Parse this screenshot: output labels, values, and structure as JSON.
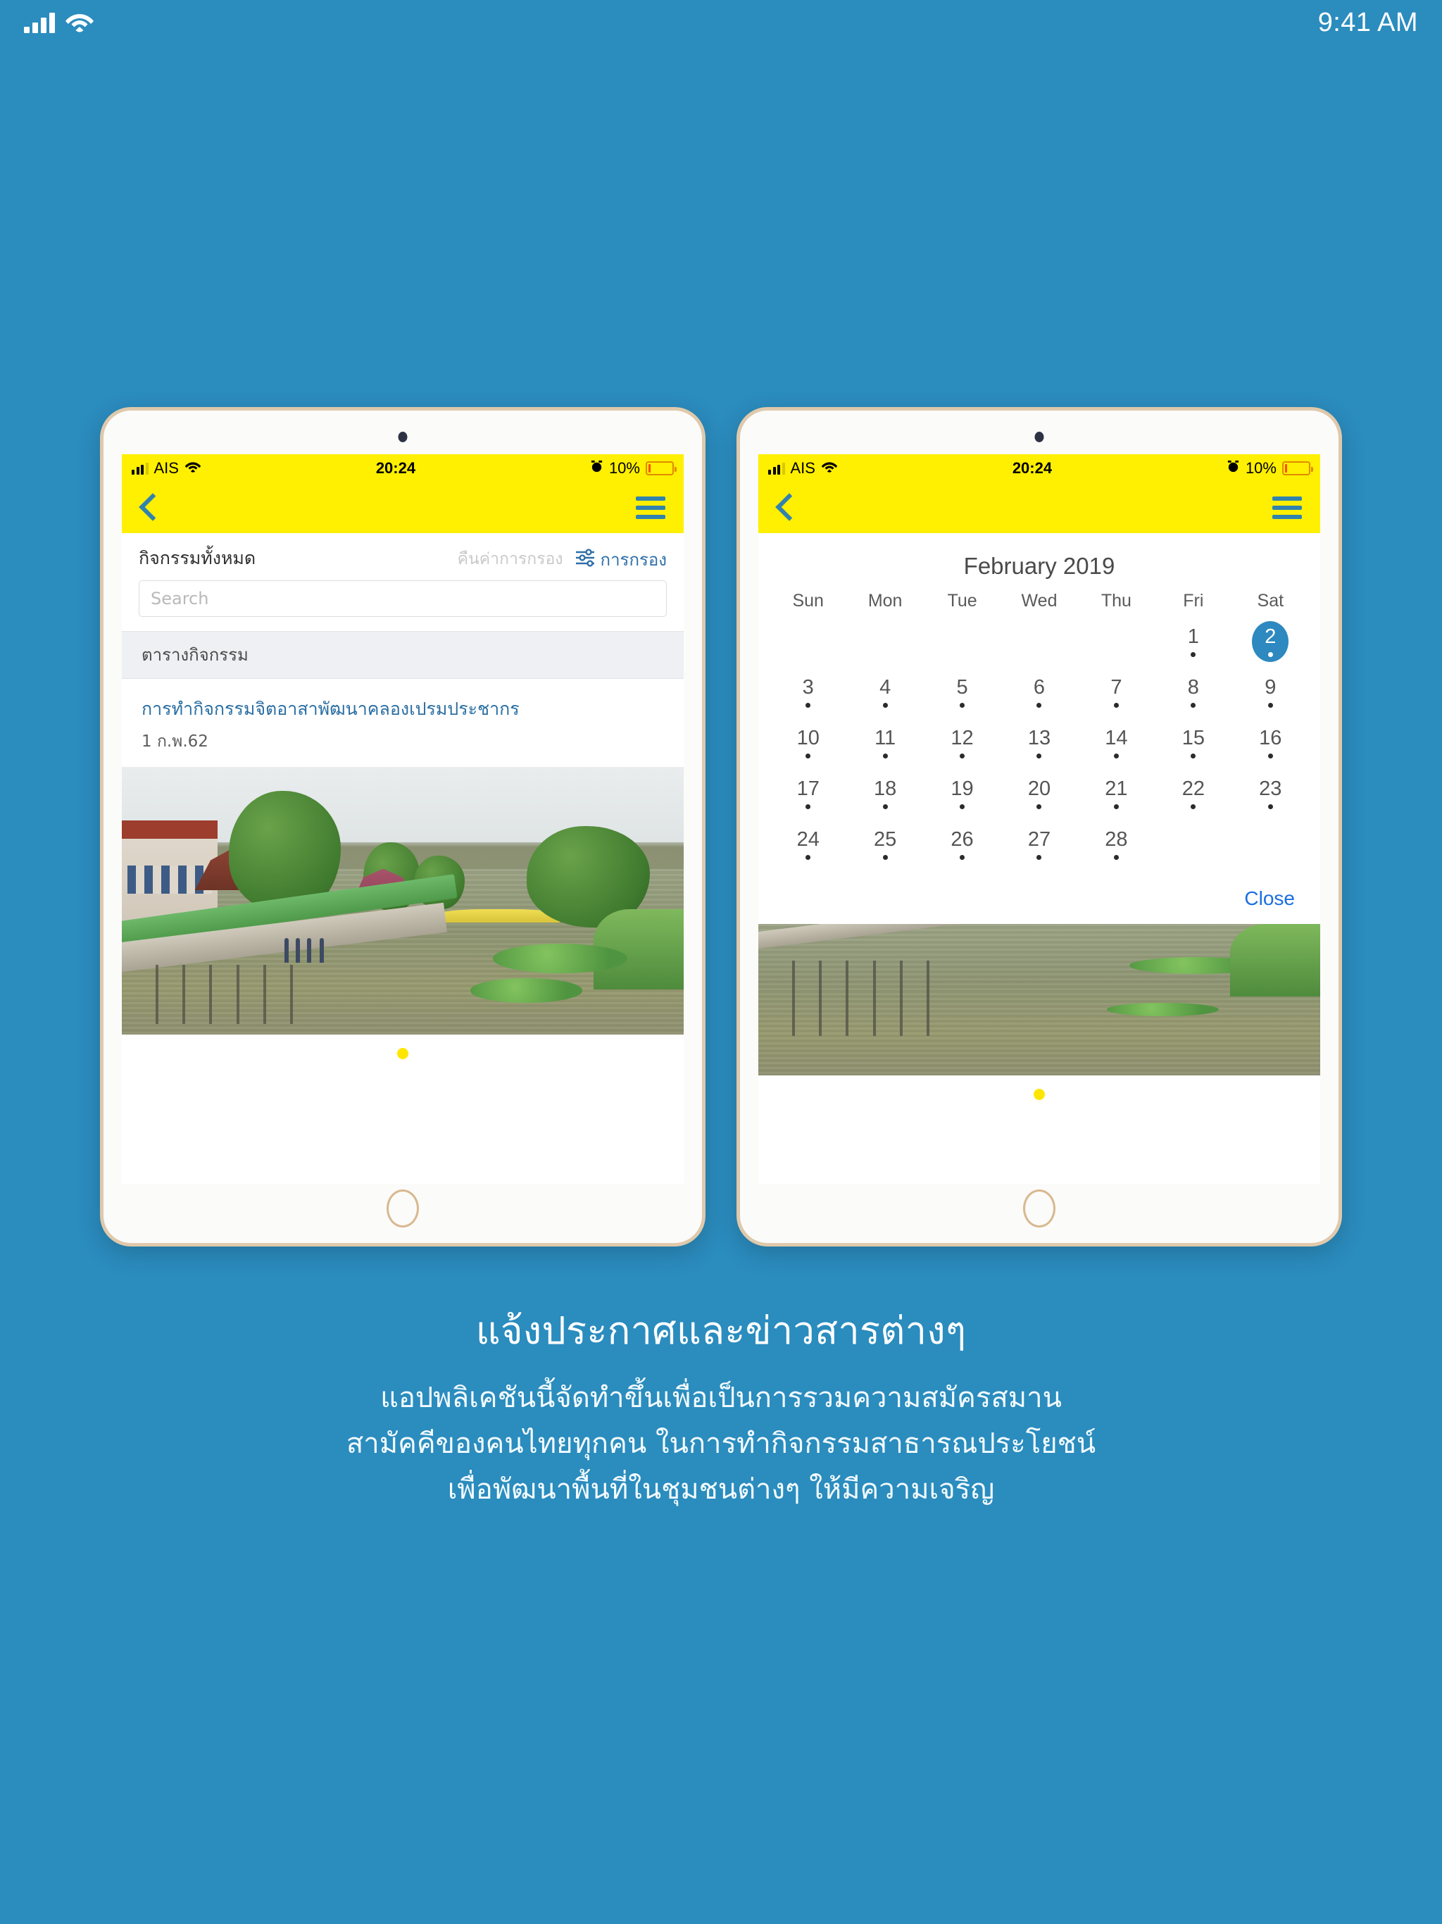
{
  "os_status": {
    "time": "9:41 AM",
    "signal_icon": "signal-bars-icon",
    "wifi_icon": "wifi-icon"
  },
  "device_status": {
    "carrier": "AIS",
    "time": "20:24",
    "battery_percent": "10%",
    "alarm_icon": "alarm-clock-icon",
    "battery_icon": "battery-icon",
    "wifi_icon": "wifi-icon"
  },
  "navbar": {
    "back_icon": "chevron-left-icon",
    "menu_icon": "hamburger-menu-icon"
  },
  "left_screen": {
    "title": "กิจกรรมทั้งหมด",
    "reset_filter": "คืนค่าการกรอง",
    "filter_label": "การกรอง",
    "filter_icon": "sliders-filter-icon",
    "search_placeholder": "Search",
    "section_header": "ตารางกิจกรรม",
    "activity": {
      "title": "การทำกิจกรรมจิตอาสาพัฒนาคลองเปรมประชากร",
      "date": "1 ก.พ.62"
    },
    "carousel_dot_color": "#ffe600"
  },
  "right_screen": {
    "calendar": {
      "month_title": "February 2019",
      "weekday_headers": [
        "Sun",
        "Mon",
        "Tue",
        "Wed",
        "Thu",
        "Fri",
        "Sat"
      ],
      "leading_blanks": 5,
      "days": [
        {
          "n": "1",
          "dot": true,
          "selected": false
        },
        {
          "n": "2",
          "dot": true,
          "selected": true
        },
        {
          "n": "3",
          "dot": true,
          "selected": false
        },
        {
          "n": "4",
          "dot": true,
          "selected": false
        },
        {
          "n": "5",
          "dot": true,
          "selected": false
        },
        {
          "n": "6",
          "dot": true,
          "selected": false
        },
        {
          "n": "7",
          "dot": true,
          "selected": false
        },
        {
          "n": "8",
          "dot": true,
          "selected": false
        },
        {
          "n": "9",
          "dot": true,
          "selected": false
        },
        {
          "n": "10",
          "dot": true,
          "selected": false
        },
        {
          "n": "11",
          "dot": true,
          "selected": false
        },
        {
          "n": "12",
          "dot": true,
          "selected": false
        },
        {
          "n": "13",
          "dot": true,
          "selected": false
        },
        {
          "n": "14",
          "dot": true,
          "selected": false
        },
        {
          "n": "15",
          "dot": true,
          "selected": false
        },
        {
          "n": "16",
          "dot": true,
          "selected": false
        },
        {
          "n": "17",
          "dot": true,
          "selected": false
        },
        {
          "n": "18",
          "dot": true,
          "selected": false
        },
        {
          "n": "19",
          "dot": true,
          "selected": false
        },
        {
          "n": "20",
          "dot": true,
          "selected": false
        },
        {
          "n": "21",
          "dot": true,
          "selected": false
        },
        {
          "n": "22",
          "dot": true,
          "selected": false
        },
        {
          "n": "23",
          "dot": true,
          "selected": false
        },
        {
          "n": "24",
          "dot": true,
          "selected": false
        },
        {
          "n": "25",
          "dot": true,
          "selected": false
        },
        {
          "n": "26",
          "dot": true,
          "selected": false
        },
        {
          "n": "27",
          "dot": true,
          "selected": false
        },
        {
          "n": "28",
          "dot": true,
          "selected": false
        }
      ],
      "close_label": "Close",
      "selected_bg": "#2d89bf",
      "close_color": "#1a6fe0"
    },
    "carousel_dot_color": "#ffe600"
  },
  "caption": {
    "headline": "แจ้งประกาศและข่าวสารต่างๆ",
    "line1": "แอปพลิเคชันนี้จัดทำขึ้นเพื่อเป็นการรวมความสมัครสมาน",
    "line2": "สามัคคีของคนไทยทุกคน ในการทำกิจกรรมสาธารณประโยชน์",
    "line3": "เพื่อพัฒนาพื้นที่ในชุมชนต่างๆ ให้มีความเจริญ"
  },
  "colors": {
    "page_background": "#2b8cbe",
    "app_bar_yellow": "#ffef00",
    "accent_blue": "#3183ae"
  }
}
